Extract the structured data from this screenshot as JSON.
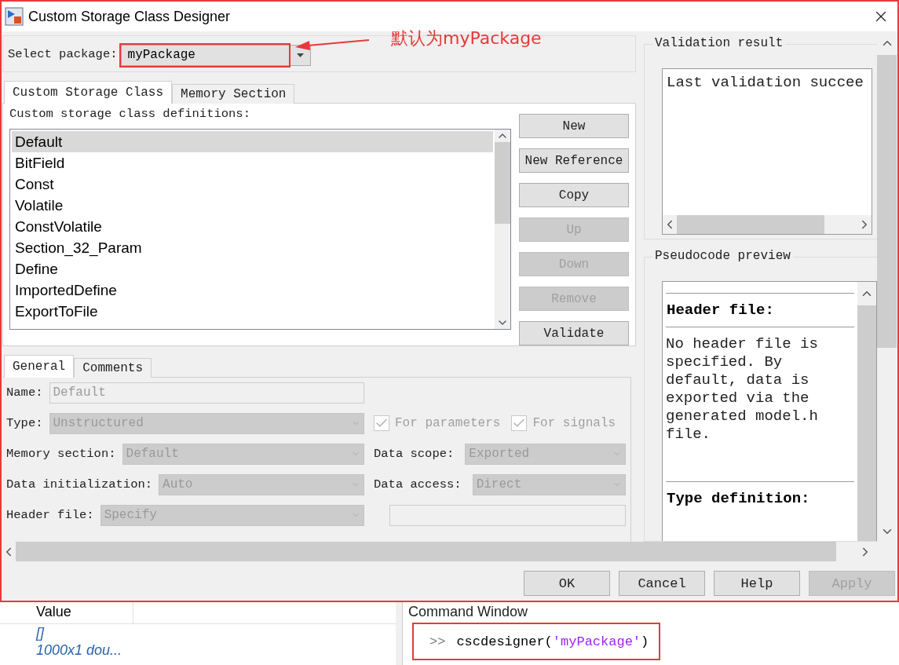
{
  "dialog": {
    "title": "Custom Storage Class Designer"
  },
  "package": {
    "label": "Select package:",
    "value": "myPackage"
  },
  "annotation": {
    "text": "默认为myPackage"
  },
  "tabs": [
    {
      "label": "Custom Storage Class",
      "selected": true
    },
    {
      "label": "Memory Section",
      "selected": false
    }
  ],
  "definitions": {
    "label": "Custom storage class definitions:",
    "items": [
      {
        "label": "Default",
        "selected": true
      },
      {
        "label": "BitField",
        "selected": false
      },
      {
        "label": "Const",
        "selected": false
      },
      {
        "label": "Volatile",
        "selected": false
      },
      {
        "label": "ConstVolatile",
        "selected": false
      },
      {
        "label": "Section_32_Param",
        "selected": false
      },
      {
        "label": "Define",
        "selected": false
      },
      {
        "label": "ImportedDefine",
        "selected": false
      },
      {
        "label": "ExportToFile",
        "selected": false
      }
    ]
  },
  "list_buttons": [
    {
      "label": "New",
      "disabled": false
    },
    {
      "label": "New Reference",
      "disabled": false
    },
    {
      "label": "Copy",
      "disabled": false
    },
    {
      "label": "Up",
      "disabled": true
    },
    {
      "label": "Down",
      "disabled": true
    },
    {
      "label": "Remove",
      "disabled": true
    },
    {
      "label": "Validate",
      "disabled": false
    }
  ],
  "detail_tabs": [
    {
      "label": "General",
      "selected": true
    },
    {
      "label": "Comments",
      "selected": false
    }
  ],
  "form": {
    "rows": [
      {
        "fields": [
          {
            "kind": "text",
            "label": "Name:",
            "value": "Default",
            "disabled": true
          }
        ]
      },
      {
        "fields": [
          {
            "kind": "select",
            "label": "Type:",
            "value": "Unstructured",
            "disabled": true
          },
          {
            "kind": "checkbox",
            "label": "For parameters",
            "checked": true,
            "disabled": true
          },
          {
            "kind": "checkbox",
            "label": "For signals",
            "checked": true,
            "disabled": true
          }
        ]
      },
      {
        "fields": [
          {
            "kind": "select",
            "label": "Memory section:",
            "value": "Default",
            "disabled": true
          },
          {
            "kind": "select",
            "label": "Data scope:",
            "value": "Exported",
            "disabled": true
          }
        ]
      },
      {
        "fields": [
          {
            "kind": "select",
            "label": "Data initialization:",
            "value": "Auto",
            "disabled": true
          },
          {
            "kind": "select",
            "label": "Data access:",
            "value": "Direct",
            "disabled": true
          }
        ]
      },
      {
        "fields": [
          {
            "kind": "select",
            "label": "Header file:",
            "value": "Specify",
            "disabled": true
          },
          {
            "kind": "text",
            "disabled": true
          }
        ]
      }
    ]
  },
  "validation": {
    "title": "Validation result",
    "text": "Last validation succee"
  },
  "pseudocode": {
    "title": "Pseudocode preview",
    "sections": [
      {
        "heading": "Header file:",
        "text": "No header file is specified. By default, data is exported via the generated model.h file."
      },
      {
        "heading": "Type definition:"
      }
    ]
  },
  "buttons": [
    {
      "label": "OK",
      "disabled": false
    },
    {
      "label": "Cancel",
      "disabled": false
    },
    {
      "label": "Help",
      "disabled": false
    },
    {
      "label": "Apply",
      "disabled": true
    }
  ],
  "workspace": {
    "columns": [
      {
        "label": "Value"
      }
    ],
    "values": [
      "[]",
      "1000x1 dou..."
    ]
  },
  "command_window": {
    "title": "Command Window",
    "prompt": ">>",
    "command": "cscdesigner(",
    "argument": "'myPackage'",
    "close": ")"
  }
}
